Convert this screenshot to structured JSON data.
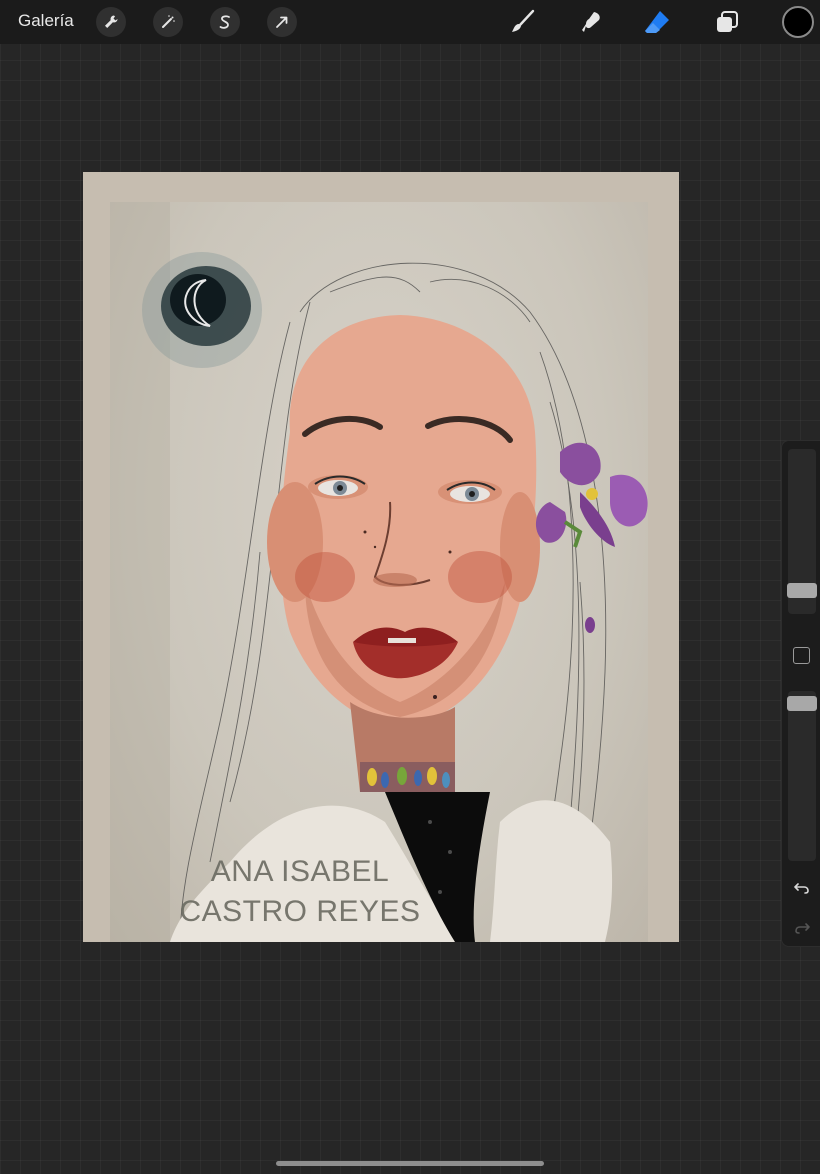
{
  "topbar": {
    "gallery_label": "Galería",
    "left_tools": [
      "wrench-icon",
      "magic-wand-icon",
      "selection-icon",
      "transform-icon"
    ],
    "right_tools": [
      "brush-icon",
      "smudge-icon",
      "eraser-icon",
      "layers-icon"
    ],
    "active_tool": "eraser-icon",
    "accent_color": "#1f7cf2",
    "current_color": "#000000"
  },
  "canvas": {
    "watermark_line1": "ANA ISABEL",
    "watermark_line2": "CASTRO REYES"
  },
  "sidebar": {
    "brush_size_icon": "size-slider",
    "opacity_icon": "opacity-slider",
    "modify_icon": "square-icon",
    "undo_icon": "undo-icon",
    "redo_icon": "redo-icon"
  }
}
